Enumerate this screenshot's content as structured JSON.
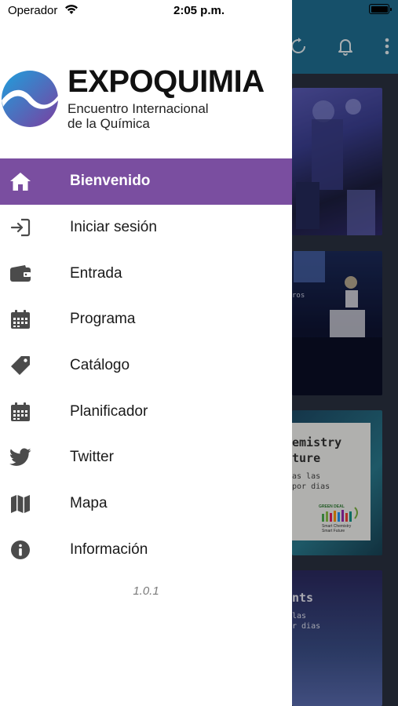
{
  "status_bar": {
    "carrier": "Operador",
    "time": "2:05 p.m."
  },
  "brand": {
    "name": "EXPOQUIMIA",
    "tagline_line1": "Encuentro Internacional",
    "tagline_line2": "de la Química"
  },
  "menu": {
    "items": [
      {
        "label": "Bienvenido",
        "icon": "home-icon",
        "active": true
      },
      {
        "label": "Iniciar sesión",
        "icon": "sign-in-icon",
        "active": false
      },
      {
        "label": "Entrada",
        "icon": "wallet-icon",
        "active": false
      },
      {
        "label": "Programa",
        "icon": "calendar-icon",
        "active": false
      },
      {
        "label": "Catálogo",
        "icon": "tag-icon",
        "active": false
      },
      {
        "label": "Planificador",
        "icon": "calendar-icon",
        "active": false
      },
      {
        "label": "Twitter",
        "icon": "twitter-icon",
        "active": false
      },
      {
        "label": "Mapa",
        "icon": "map-icon",
        "active": false
      },
      {
        "label": "Información",
        "icon": "info-icon",
        "active": false
      }
    ]
  },
  "version": "1.0.1",
  "background_cards": {
    "card2_text": "ros",
    "card3_title_line1": "emistry",
    "card3_title_line2": "ture",
    "card3_body_line1": "as las",
    "card3_body_line2": "por dias",
    "card3_badge_line1": "GREEN DEAL",
    "card3_badge_line2": "Smart Chemistry",
    "card3_badge_line3": "Smart Future",
    "card4_title": "nts",
    "card4_body_line1": "las",
    "card4_body_line2": "r dias"
  },
  "colors": {
    "accent": "#7a4ea0",
    "topbar": "#1f6f93",
    "logo_gradient_start": "#1ea0dc",
    "logo_gradient_end": "#7b3fa0"
  }
}
